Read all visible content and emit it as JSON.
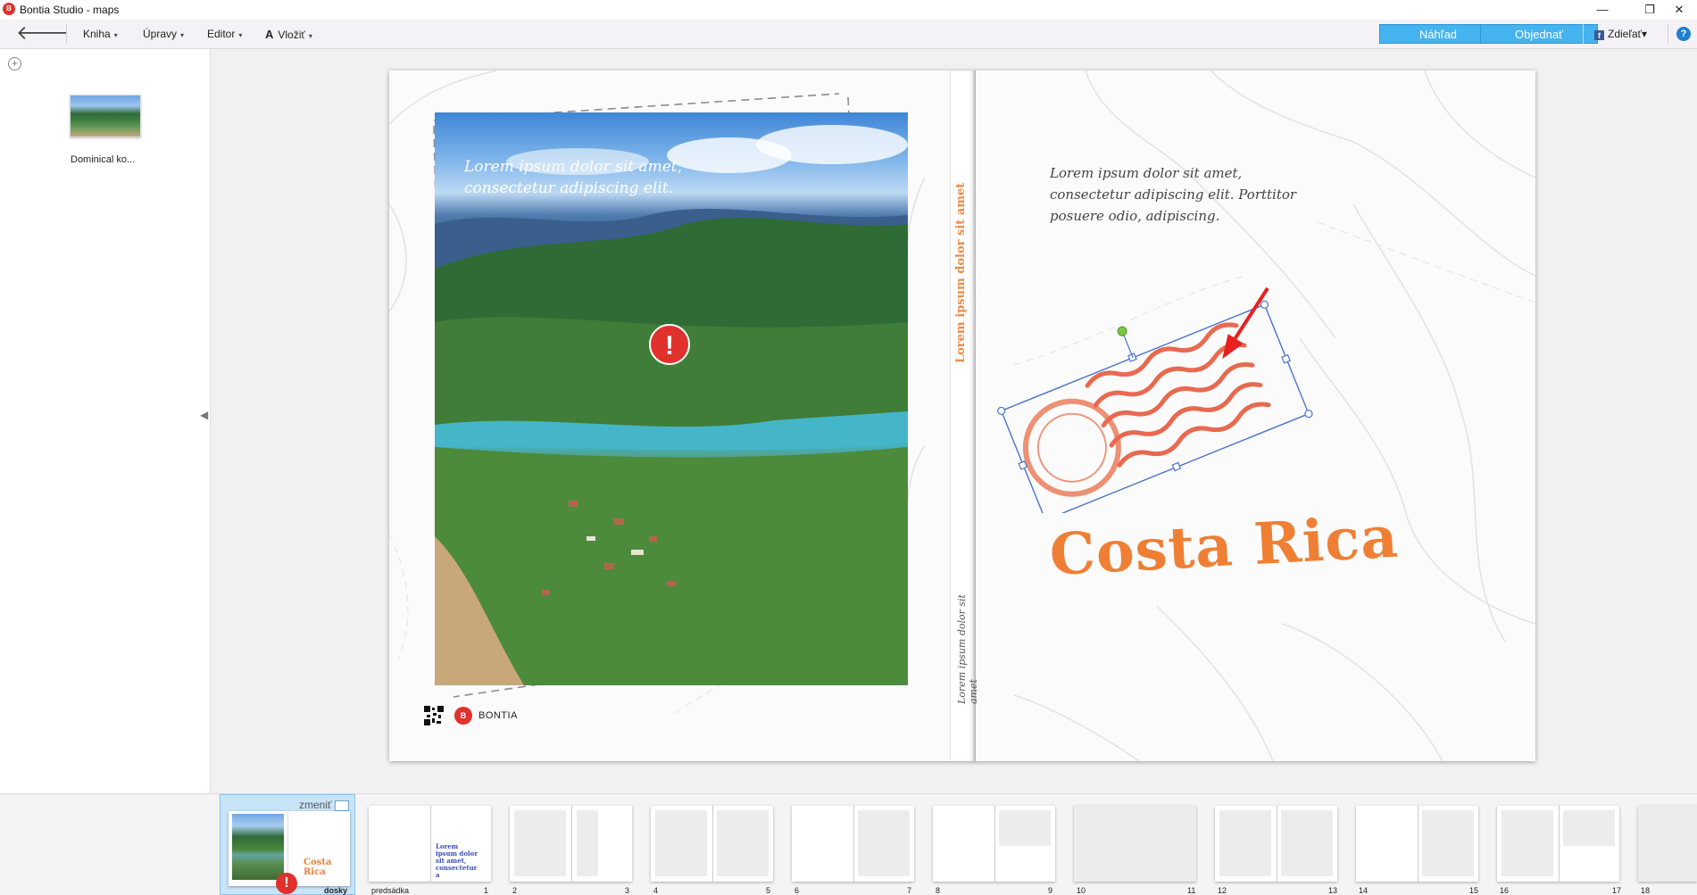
{
  "window": {
    "title": "Bontia Studio - maps",
    "logo_text": "B",
    "minimize_glyph": "—",
    "restore_glyph": "❐",
    "close_glyph": "✕"
  },
  "menu": {
    "back_glyph": "🡐",
    "items": [
      "Kniha",
      "Úpravy",
      "Editor",
      "Vložiť"
    ],
    "insert_icon": "A",
    "caret": "▾",
    "preview_label": "Náhľad",
    "order_label": "Objednať",
    "share_label": "Zdieľať",
    "share_icon_text": "f",
    "help_text": "?"
  },
  "left_panel": {
    "add_glyph": "+",
    "photo_label": "Dominical ko...",
    "collapse_glyph": "◀"
  },
  "cover": {
    "left_text_line1": "Lorem ipsum dolor sit amet,",
    "left_text_line2": "consectetur adipiscing elit.",
    "warning_glyph": "!",
    "brand_logo_text": "B",
    "brand_name": "BONTIA",
    "spine_top": "Lorem ipsum dolor sit amet",
    "spine_bottom": "Lorem ipsum dolor sit amet",
    "right_text": "Lorem ipsum dolor sit amet, consectetur adipiscing elit. Porttitor posuere odio, adipiscing.",
    "title": "Costa Rica",
    "accent_color": "#ef7f34",
    "warning_color": "#e0312d"
  },
  "filmstrip": {
    "change_label": "zmeniť",
    "mini_title": "Costa Rica",
    "mini_lorem": "Lorem ipsum dolor sit amet, consectetur",
    "pages": [
      {
        "label": "doski_left",
        "text": ""
      },
      {
        "label": "dosky",
        "text": "dosky"
      },
      {
        "label": "predsadka",
        "text": "predsádka"
      },
      {
        "label": "p1",
        "text": "1"
      },
      {
        "label": "p2",
        "text": "2"
      },
      {
        "label": "p3",
        "text": "3"
      },
      {
        "label": "p4",
        "text": "4"
      },
      {
        "label": "p5",
        "text": "5"
      },
      {
        "label": "p6",
        "text": "6"
      },
      {
        "label": "p7",
        "text": "7"
      },
      {
        "label": "p8",
        "text": "8"
      },
      {
        "label": "p9",
        "text": "9"
      },
      {
        "label": "p10",
        "text": "10"
      },
      {
        "label": "p11",
        "text": "11"
      },
      {
        "label": "p12",
        "text": "12"
      },
      {
        "label": "p13",
        "text": "13"
      },
      {
        "label": "p14",
        "text": "14"
      },
      {
        "label": "p15",
        "text": "15"
      },
      {
        "label": "p16",
        "text": "16"
      },
      {
        "label": "p17",
        "text": "17"
      },
      {
        "label": "p18",
        "text": "18"
      }
    ],
    "predsadka_text": "Lorem ipsum dolor sit amet, consectetur a"
  }
}
